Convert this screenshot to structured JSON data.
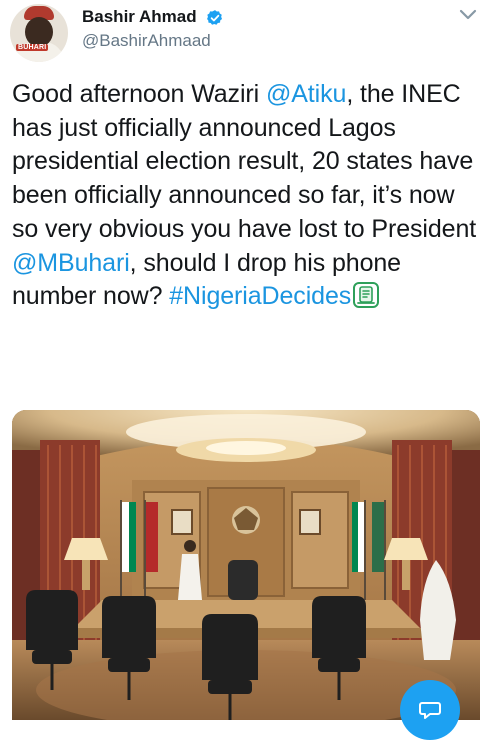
{
  "user": {
    "display_name": "Bashir Ahmad",
    "handle": "@BashirAhmaad",
    "avatar_badge": "BUHARI"
  },
  "tweet": {
    "part1": "Good afternoon Waziri ",
    "mention_atiku": "@Atiku",
    "part2": ", the INEC has just officially announced Lagos presidential election result, 20 states have been officially announced so far, it’s now so very obvious you have lost to President ",
    "mention_buhari": "@MBuhari",
    "part3": ", should I drop his phone number now? ",
    "hashtag": "#NigeriaDecides"
  },
  "colors": {
    "link": "#1b95e0",
    "verified": "#1da1f2",
    "fab": "#1da1f2",
    "text": "#14171a",
    "muted": "#657786"
  },
  "icons": [
    "verified-badge-icon",
    "chevron-down-icon",
    "ballot-emoji-icon",
    "compose-reply-icon"
  ]
}
